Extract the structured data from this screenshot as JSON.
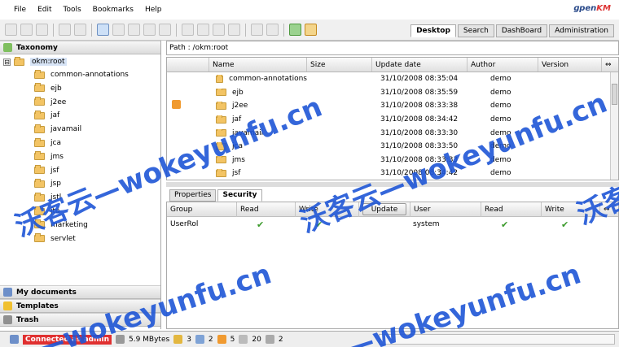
{
  "menu": [
    "File",
    "Edit",
    "Tools",
    "Bookmarks",
    "Help"
  ],
  "logo": {
    "prefix": "ɡpen",
    "suffix": "KM"
  },
  "main_tabs": [
    {
      "label": "Desktop",
      "active": true
    },
    {
      "label": "Search",
      "active": false
    },
    {
      "label": "DashBoard",
      "active": false
    },
    {
      "label": "Administration",
      "active": false
    }
  ],
  "stack": {
    "taxonomy": "Taxonomy",
    "my_documents": "My documents",
    "templates": "Templates",
    "trash": "Trash"
  },
  "tree": {
    "toggle": "⊟",
    "root": "okm:root",
    "children": [
      "common-annotations",
      "ejb",
      "j2ee",
      "jaf",
      "javamail",
      "jca",
      "jms",
      "jsf",
      "jsp",
      "jstl",
      "jta",
      "marketing",
      "servlet"
    ]
  },
  "path": {
    "label": "Path :",
    "value": "/okm:root"
  },
  "grid": {
    "columns": [
      "Name",
      "Size",
      "Update date",
      "Author",
      "Version"
    ],
    "rows": [
      {
        "name": "common-annotations",
        "size": "",
        "date": "31/10/2008 08:35:04",
        "author": "demo"
      },
      {
        "name": "ejb",
        "size": "",
        "date": "31/10/2008 08:35:59",
        "author": "demo"
      },
      {
        "name": "j2ee",
        "size": "",
        "date": "31/10/2008 08:33:38",
        "author": "demo"
      },
      {
        "name": "jaf",
        "size": "",
        "date": "31/10/2008 08:34:42",
        "author": "demo"
      },
      {
        "name": "javamail",
        "size": "",
        "date": "31/10/2008 08:33:30",
        "author": "demo"
      },
      {
        "name": "jca",
        "size": "",
        "date": "31/10/2008 08:33:50",
        "author": "demo"
      },
      {
        "name": "jms",
        "size": "",
        "date": "31/10/2008 08:33:33",
        "author": "demo"
      },
      {
        "name": "jsf",
        "size": "",
        "date": "31/10/2008 08:34:42",
        "author": "demo"
      }
    ]
  },
  "lower_tabs": [
    {
      "label": "Properties",
      "active": false
    },
    {
      "label": "Security",
      "active": true
    }
  ],
  "security": {
    "group_cols": [
      "Group",
      "Read",
      "Write"
    ],
    "update_label": "Update",
    "user_cols": [
      "User",
      "Read",
      "Write"
    ],
    "group_rows": [
      {
        "name": "UserRol",
        "read": "✔",
        "write": "✔"
      }
    ],
    "user_rows": [
      {
        "name": "system",
        "read": "✔",
        "write": "✔"
      }
    ]
  },
  "status": {
    "connected": "Connected as admin",
    "memory": "5.9 MBytes",
    "locked": "3",
    "checkout": "2",
    "subscribed": "5",
    "mail": "20",
    "workflow": "2"
  },
  "watermark": {
    "cn": "沃客云",
    "domain": "wokeyunfu.cn"
  }
}
